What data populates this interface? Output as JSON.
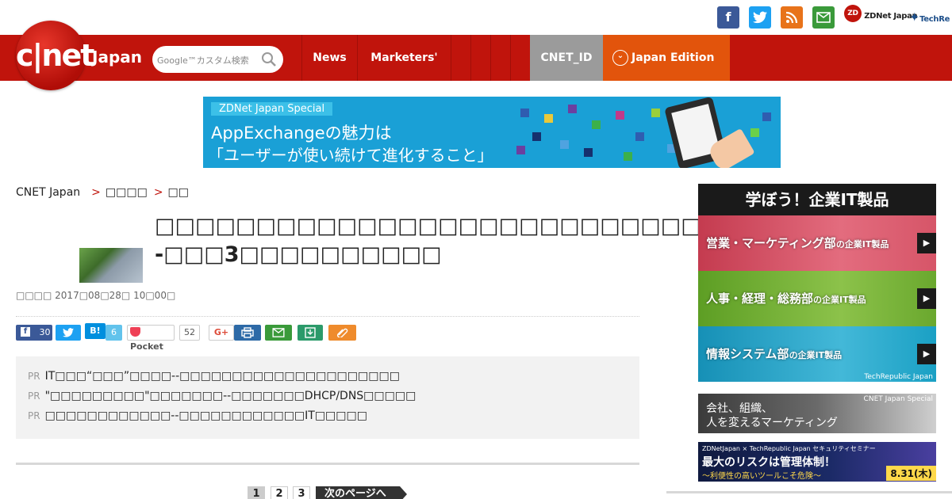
{
  "topbar": {
    "icons": [
      "facebook-icon",
      "twitter-icon",
      "rss-icon",
      "mail-icon"
    ],
    "zdnet": "ZDNet Japan",
    "techrepublic": "TechRe"
  },
  "header": {
    "logo": "c|net",
    "logo_region": "Japan",
    "search_placeholder": "Google™カスタム検索",
    "nav": [
      "News",
      "Marketers'"
    ],
    "cnet_id": "CNET_ID",
    "edition": "Japan Edition",
    "colors": {
      "bar": "#c0140c",
      "id": "#9b9b9b",
      "edition": "#e2540c"
    }
  },
  "banner": {
    "tag": "ZDNet Japan Special",
    "line1": "AppExchangeの魅力は",
    "line2": "「ユーザーが使い続けて進化すること」"
  },
  "breadcrumb": [
    "CNET Japan",
    "□□□□",
    "□□"
  ],
  "article": {
    "title": "□□□□□□□□□□□□□□□□□□□□□□□□□□□□□--□□□3□□□□□□□□□□",
    "meta": "□□□□  2017□08□28□ 10□00□"
  },
  "share": {
    "fb_count": "30",
    "hatena": "B!",
    "hatena_count": "6",
    "pocket": "Pocket",
    "pocket_count": "52",
    "gplus": "G+"
  },
  "pr": {
    "tag": "PR",
    "items": [
      "IT□□□“□□□”□□□□--□□□□□□□□□□□□□□□□□□□□□",
      "\"□□□□□□□□□\"□□□□□□□--□□□□□□□DHCP/DNS□□□□□",
      "□□□□□□□□□□□□--□□□□□□□□□□□□IT□□□□□"
    ]
  },
  "pagination": {
    "pages": [
      "1",
      "2",
      "3"
    ],
    "current": "1",
    "next": "次のページへ"
  },
  "sidebar": {
    "head": "学ぼう！企業IT製品",
    "blocks": [
      {
        "label": "営業・マーケティング部",
        "suffix": "の企業IT製品",
        "color": "#d04a5a"
      },
      {
        "label": "人事・経理・総務部",
        "suffix": "の企業IT製品",
        "color": "#6aa82e"
      },
      {
        "label": "情報システム部",
        "suffix": "の企業IT製品",
        "color": "#1aa0c4"
      }
    ],
    "techrepublic": "TechRepublic Japan",
    "ad1_tag": "CNET Japan Special",
    "ad1_line1": "会社、組織、",
    "ad1_line2": "人を変えるマーケティング",
    "ad2_tag": "ZDNetJapan × TechRepublic Japan セキュリティセミナー",
    "ad2_line1": "最大のリスクは管理体制！",
    "ad2_line2": "〜利便性の高いツールこそ危険〜",
    "ad2_date": "8.31(木)"
  }
}
